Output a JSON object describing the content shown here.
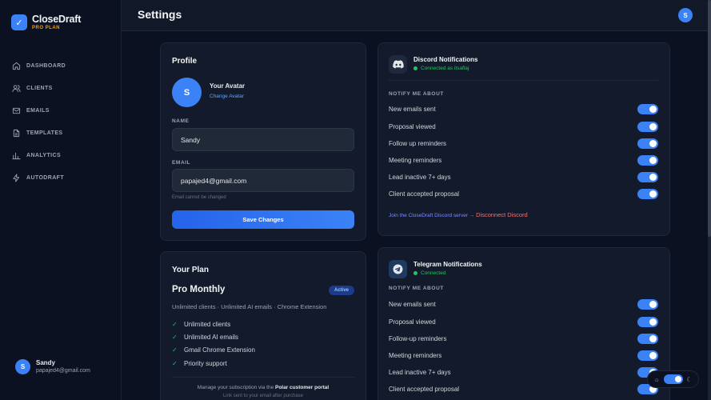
{
  "brand": {
    "name": "CloseDraft",
    "plan": "PRO PLAN"
  },
  "nav": [
    {
      "label": "DASHBOARD",
      "icon": "home-icon"
    },
    {
      "label": "CLIENTS",
      "icon": "users-icon"
    },
    {
      "label": "EMAILS",
      "icon": "mail-icon"
    },
    {
      "label": "TEMPLATES",
      "icon": "document-icon"
    },
    {
      "label": "ANALYTICS",
      "icon": "bar-chart-icon"
    },
    {
      "label": "AUTODRAFT",
      "icon": "lightning-icon"
    }
  ],
  "user": {
    "initial": "S",
    "name": "Sandy",
    "email": "papajed4@gmail.com"
  },
  "header": {
    "title": "Settings",
    "avatar_initial": "S"
  },
  "profile": {
    "title": "Profile",
    "avatar_initial": "S",
    "avatar_heading": "Your Avatar",
    "change_avatar": "Change Avatar",
    "name_label": "NAME",
    "name_value": "Sandy",
    "email_label": "EMAIL",
    "email_value": "papajed4@gmail.com",
    "email_note": "Email cannot be changed",
    "save_label": "Save Changes"
  },
  "plan": {
    "title": "Your Plan",
    "name": "Pro Monthly",
    "badge": "Active",
    "summary": "Unlimited clients · Unlimited AI emails · Chrome Extension",
    "features": [
      "Unlimited clients",
      "Unlimited AI emails",
      "Gmail Chrome Extension",
      "Priority support"
    ],
    "portal_prefix": "Manage your subscription via the",
    "portal_link": "Polar customer portal",
    "portal_note": "Link sent to your email after purchase"
  },
  "discord": {
    "title": "Discord Notifications",
    "status": "Connected as itsaflaj",
    "section_label": "NOTIFY ME ABOUT",
    "items": [
      "New emails sent",
      "Proposal viewed",
      "Follow up reminders",
      "Meeting reminders",
      "Lead inactive 7+ days",
      "Client accepted proposal"
    ],
    "join_text": "Join the CloseDraft Discord server →",
    "disconnect": "Disconnect Discord"
  },
  "telegram": {
    "title": "Telegram Notifications",
    "status": "Connected",
    "section_label": "NOTIFY ME ABOUT",
    "items": [
      "New emails sent",
      "Proposal viewed",
      "Follow-up reminders",
      "Meeting reminders",
      "Lead inactive 7+ days",
      "Client accepted proposal"
    ]
  },
  "colors": {
    "accent": "#3b82f6",
    "success": "#22c55e",
    "danger": "#f87171",
    "brand_plan": "#f59e0b"
  }
}
